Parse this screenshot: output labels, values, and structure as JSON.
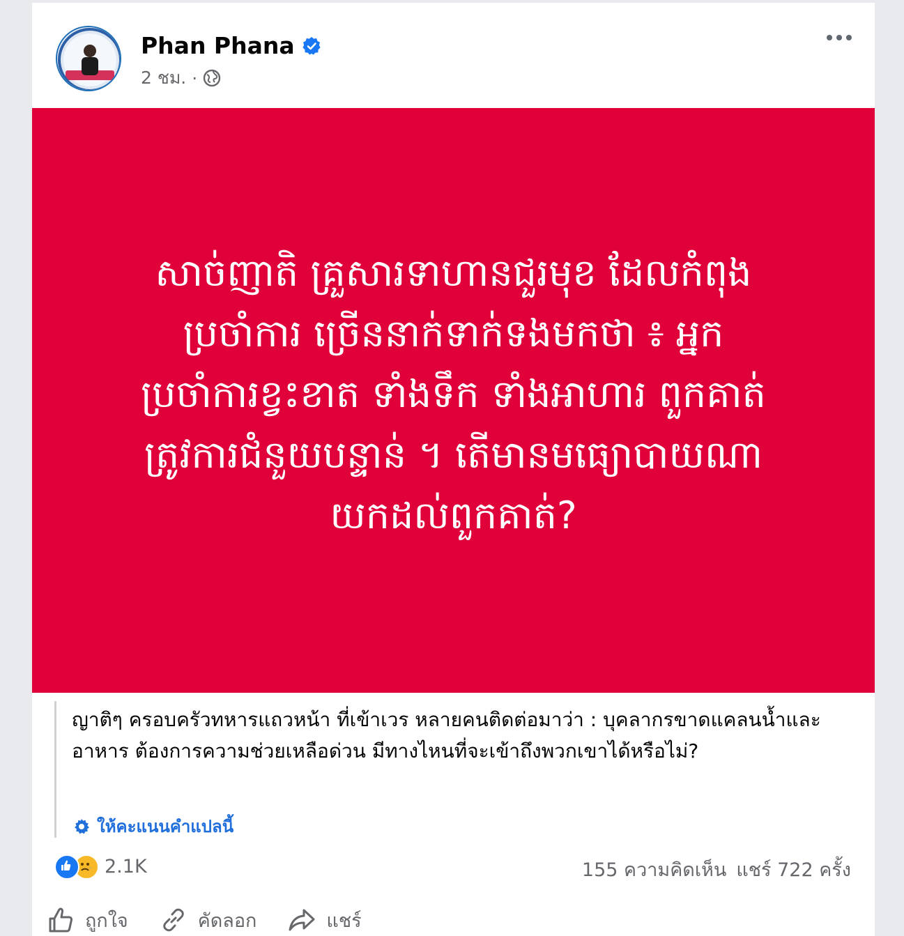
{
  "post": {
    "author": "Phan Phana",
    "time": "2 ชม.",
    "separator": "·",
    "privacy_icon": "globe-icon",
    "verified_icon": "verified-badge-icon"
  },
  "banner": {
    "text": "សាច់ញាតិ គ្រួសារទាហានជួរមុខ ដែលកំពុង\nប្រចាំការ ច្រើននាក់ទាក់ទងមកថា ៖ អ្នក\nប្រចាំការខ្វះខាត ទាំងទឹក ទាំងអាហារ ពួកគាត់\nត្រូវការជំនួយបន្ទាន់ ។ តើមានមធ្យោបាយណា\nយកដល់ពួកគាត់?",
    "background": "#e0003a"
  },
  "translation": {
    "text": "ญาติๆ ครอบครัวทหารแถวหน้า ที่เข้าเวร หลายคนติดต่อมาว่า : บุคลากรขาดแคลนน้ำและอาหาร ต้องการความช่วยเหลือด่วน มีทางไหนที่จะเข้าถึงพวกเขาได้หรือไม่?",
    "rate_label": "ให้คะแนนคำแปลนี้",
    "rate_icon": "gear-icon"
  },
  "stats": {
    "reactions_count": "2.1K",
    "comments": "155 ความคิดเห็น",
    "shares": "แชร์ 722 ครั้ง"
  },
  "actions": {
    "like": "ถูกใจ",
    "comment": "คัดลอก",
    "share": "แชร์"
  },
  "colors": {
    "accent": "#216fdb",
    "like_blue": "#1877f2",
    "sad_yellow": "#f7b928"
  }
}
